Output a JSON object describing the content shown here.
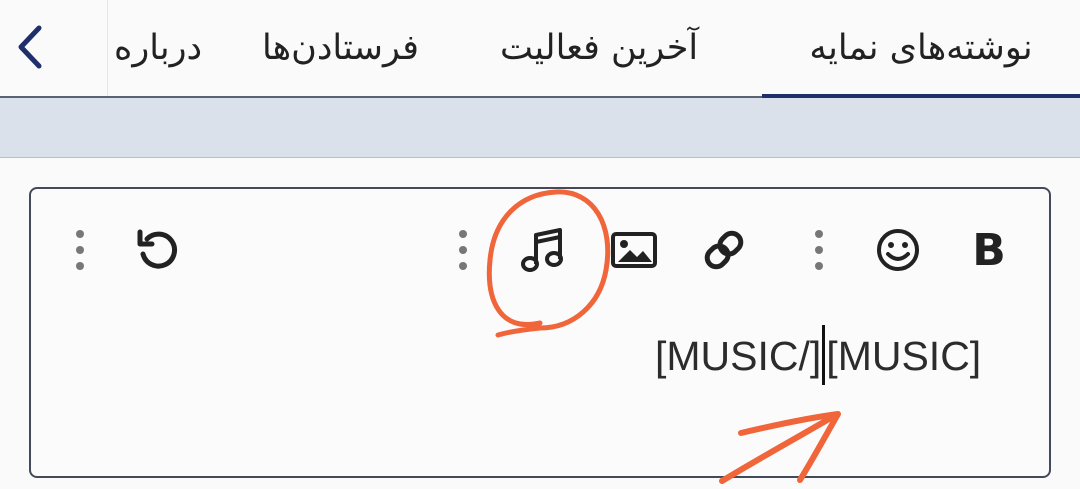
{
  "tabs": [
    {
      "label": "نوشته‌های نمایه",
      "active": true
    },
    {
      "label": "آخرین فعالیت",
      "active": false
    },
    {
      "label": "فرستادن‌ها",
      "active": false
    },
    {
      "label": "درباره",
      "active": false
    }
  ],
  "toolbar": {
    "bold_label": "B",
    "icons": [
      "bold-icon",
      "smiley-icon",
      "more-vertical-icon",
      "link-icon",
      "image-icon",
      "music-icon",
      "more-vertical-icon",
      "undo-icon",
      "more-vertical-icon"
    ]
  },
  "editor": {
    "text_before_caret": "[MUSIC/]",
    "text_after_caret": "[MUSIC]"
  },
  "colors": {
    "active_tab_underline": "#1f2f6b",
    "annotation": "#f0653a",
    "band": "#dbe1ea"
  }
}
